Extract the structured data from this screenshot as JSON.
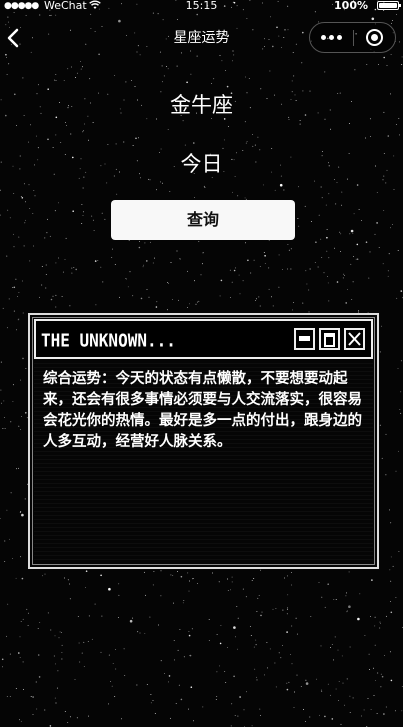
{
  "status_bar": {
    "signal": "●●●●●",
    "carrier": "WeChat",
    "wifi_icon": "wifi-icon",
    "time": "15:15",
    "battery_percent": "100%"
  },
  "nav": {
    "title": "星座运势",
    "back_icon": "back-chevron-icon",
    "more_icon": "more-dots-icon",
    "close_icon": "target-close-icon"
  },
  "main": {
    "sign": "金牛座",
    "day": "今日",
    "query_button": "查询"
  },
  "window": {
    "title": "THE UNKNOWN...",
    "content": "综合运势：今天的状态有点懒散，不要想要动起来，还会有很多事情必须要与人交流落实，很容易会花光你的热情。最好是多一点的付出，跟身边的人多互动，经营好人脉关系。",
    "buttons": [
      "minimize",
      "maximize",
      "close"
    ]
  },
  "colors": {
    "background": "#050505",
    "text": "#ffffff",
    "button_bg": "#f8f8f8",
    "button_text": "#111111",
    "window_border": "#eeeeee"
  }
}
